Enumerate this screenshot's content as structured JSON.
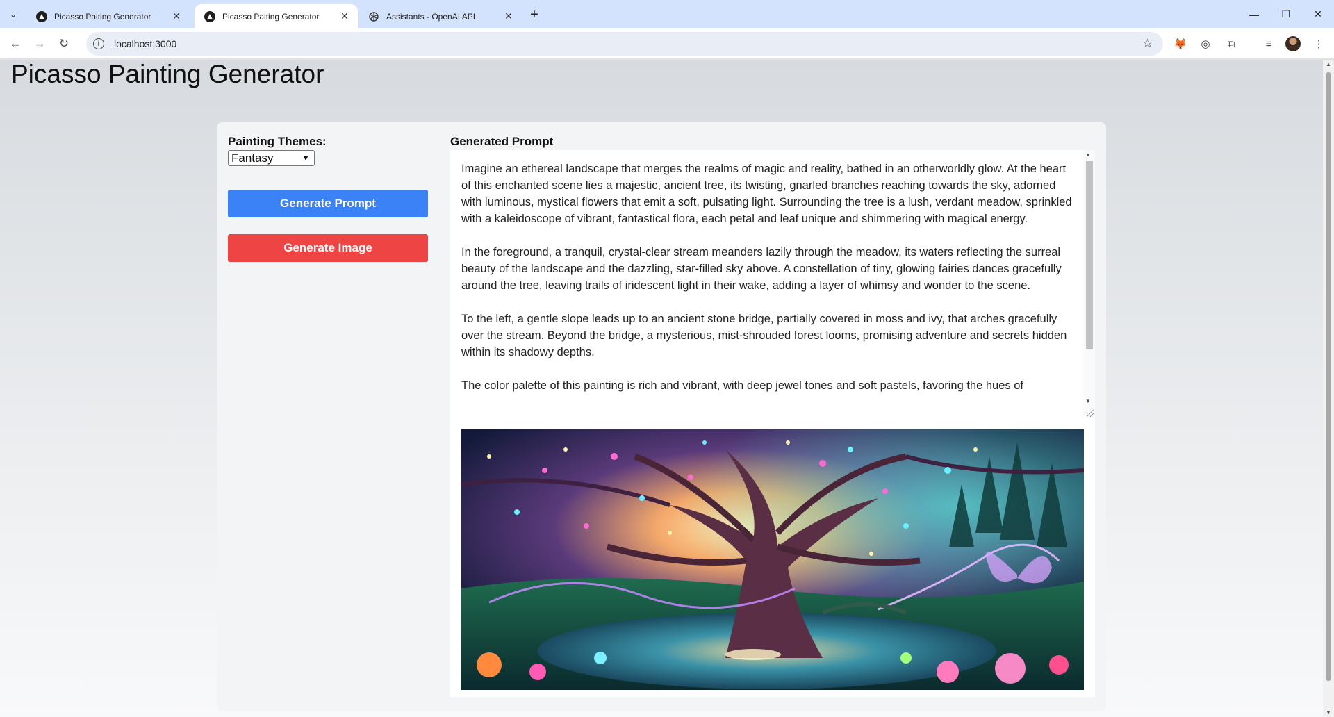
{
  "browser": {
    "tabs": [
      {
        "title": "Picasso Paiting Generator",
        "favicon": "app-icon",
        "active": false
      },
      {
        "title": "Picasso Paiting Generator",
        "favicon": "app-icon",
        "active": true
      },
      {
        "title": "Assistants - OpenAI API",
        "favicon": "openai-icon",
        "active": false
      }
    ],
    "url": "localhost:3000"
  },
  "page": {
    "title": "Picasso Painting Generator"
  },
  "controls": {
    "themes_label": "Painting Themes:",
    "theme_selected": "Fantasy",
    "generate_prompt_label": "Generate Prompt",
    "generate_image_label": "Generate Image",
    "colors": {
      "prompt_button": "#3b82f6",
      "image_button": "#ef4444"
    }
  },
  "output": {
    "prompt_heading": "Generated Prompt",
    "paragraphs": [
      "Imagine an ethereal landscape that merges the realms of magic and reality, bathed in an otherworldly glow. At the heart of this enchanted scene lies a majestic, ancient tree, its twisting, gnarled branches reaching towards the sky, adorned with luminous, mystical flowers that emit a soft, pulsating light. Surrounding the tree is a lush, verdant meadow, sprinkled with a kaleidoscope of vibrant, fantastical flora, each petal and leaf unique and shimmering with magical energy.",
      "In the foreground, a tranquil, crystal-clear stream meanders lazily through the meadow, its waters reflecting the surreal beauty of the landscape and the dazzling, star-filled sky above. A constellation of tiny, glowing fairies dances gracefully around the tree, leaving trails of iridescent light in their wake, adding a layer of whimsy and wonder to the scene.",
      "To the left, a gentle slope leads up to an ancient stone bridge, partially covered in moss and ivy, that arches gracefully over the stream. Beyond the bridge, a mysterious, mist-shrouded forest looms, promising adventure and secrets hidden within its shadowy depths.",
      "The color palette of this painting is rich and vibrant, with deep jewel tones and soft pastels, favoring the hues of"
    ]
  }
}
